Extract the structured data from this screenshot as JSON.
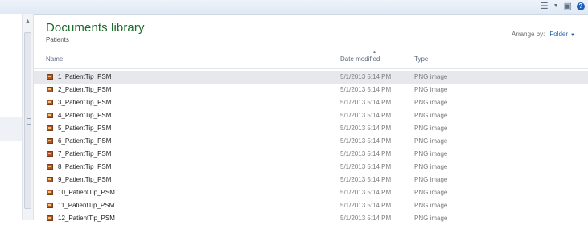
{
  "toolbar": {
    "icons": [
      "views-icon",
      "preview-pane-icon",
      "help-icon"
    ],
    "help_glyph": "?"
  },
  "library": {
    "title": "Documents library",
    "subtitle": "Patients"
  },
  "arrange": {
    "label": "Arrange by:",
    "value": "Folder"
  },
  "columns": {
    "name": "Name",
    "date": "Date modified",
    "type": "Type"
  },
  "files": [
    {
      "name": "1_PatientTip_PSM",
      "date": "5/1/2013 5:14 PM",
      "type": "PNG image",
      "selected": true
    },
    {
      "name": "2_PatientTip_PSM",
      "date": "5/1/2013 5:14 PM",
      "type": "PNG image"
    },
    {
      "name": "3_PatientTip_PSM",
      "date": "5/1/2013 5:14 PM",
      "type": "PNG image"
    },
    {
      "name": "4_PatientTip_PSM",
      "date": "5/1/2013 5:14 PM",
      "type": "PNG image"
    },
    {
      "name": "5_PatientTip_PSM",
      "date": "5/1/2013 5:14 PM",
      "type": "PNG image"
    },
    {
      "name": "6_PatientTip_PSM",
      "date": "5/1/2013 5:14 PM",
      "type": "PNG image"
    },
    {
      "name": "7_PatientTip_PSM",
      "date": "5/1/2013 5:14 PM",
      "type": "PNG image"
    },
    {
      "name": "8_PatientTip_PSM",
      "date": "5/1/2013 5:14 PM",
      "type": "PNG image"
    },
    {
      "name": "9_PatientTip_PSM",
      "date": "5/1/2013 5:14 PM",
      "type": "PNG image"
    },
    {
      "name": "10_PatientTip_PSM",
      "date": "5/1/2013 5:14 PM",
      "type": "PNG image"
    },
    {
      "name": "11_PatientTip_PSM",
      "date": "5/1/2013 5:14 PM",
      "type": "PNG image"
    },
    {
      "name": "12_PatientTip_PSM",
      "date": "5/1/2013 5:14 PM",
      "type": "PNG image"
    }
  ],
  "colors": {
    "title": "#1e6b2b",
    "link": "#1f5fa8",
    "selected_row": "#e6e8ec",
    "file_icon": "#b2532a"
  }
}
